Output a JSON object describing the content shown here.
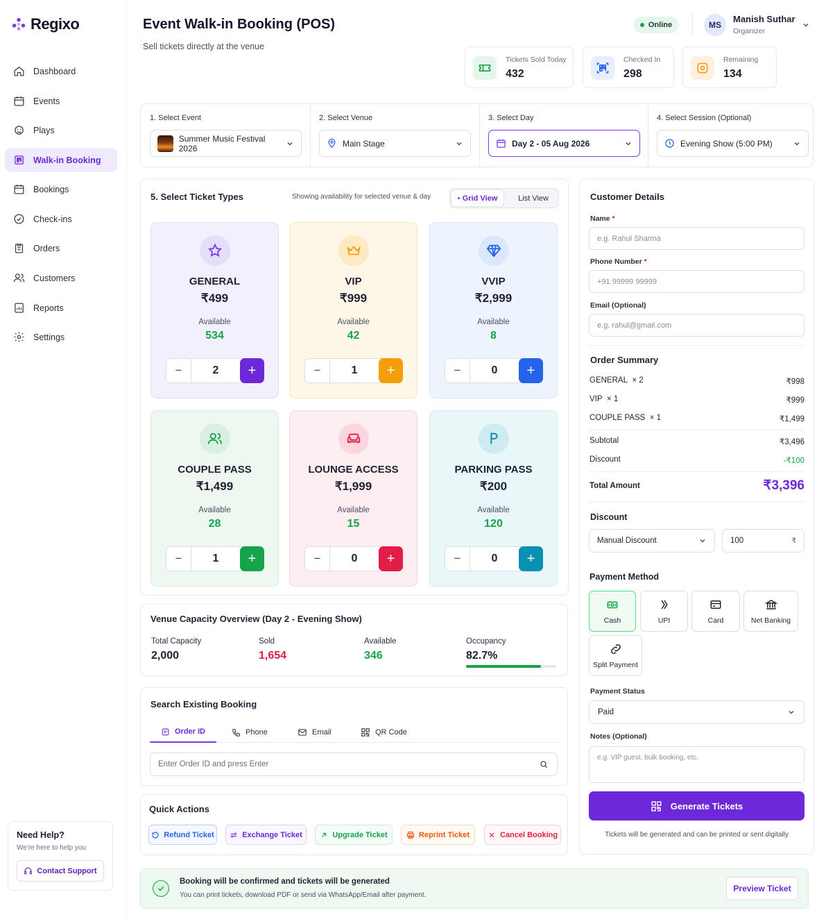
{
  "app": {
    "name": "Regixo"
  },
  "nav": {
    "items": [
      {
        "label": "Dashboard"
      },
      {
        "label": "Events"
      },
      {
        "label": "Plays"
      },
      {
        "label": "Walk-in Booking"
      },
      {
        "label": "Bookings"
      },
      {
        "label": "Check-ins"
      },
      {
        "label": "Orders"
      },
      {
        "label": "Customers"
      },
      {
        "label": "Reports"
      },
      {
        "label": "Settings"
      }
    ]
  },
  "help": {
    "title": "Need Help?",
    "subtitle": "We're here to help you",
    "button": "Contact Support"
  },
  "header": {
    "title": "Event Walk-in Booking (POS)",
    "subtitle": "Sell tickets directly at the venue",
    "status": "Online"
  },
  "user": {
    "initials": "MS",
    "name": "Manish Suthar",
    "role": "Organizer"
  },
  "stats": [
    {
      "label": "Tickets Sold Today",
      "value": "432"
    },
    {
      "label": "Checked In",
      "value": "298"
    },
    {
      "label": "Remaining",
      "value": "134"
    }
  ],
  "selectors": [
    {
      "label": "1. Select Event",
      "value": "Summer Music Festival 2026"
    },
    {
      "label": "2. Select Venue",
      "value": "Main Stage"
    },
    {
      "label": "3. Select Day",
      "value": "Day 2 - 05 Aug 2026"
    },
    {
      "label": "4. Select Session (Optional)",
      "value": "Evening Show (5:00 PM)"
    }
  ],
  "tickets": {
    "title": "5. Select Ticket Types",
    "note": "Showing availability for selected venue & day",
    "grid_view": "Grid View",
    "list_view": "List View",
    "available_label": "Available",
    "items": [
      {
        "name": "GENERAL",
        "price": "₹499",
        "available": "534",
        "qty": "2",
        "icon": "star-icon"
      },
      {
        "name": "VIP",
        "price": "₹999",
        "available": "42",
        "qty": "1",
        "icon": "crown-icon"
      },
      {
        "name": "VVIP",
        "price": "₹2,999",
        "available": "8",
        "qty": "0",
        "icon": "diamond-icon"
      },
      {
        "name": "COUPLE PASS",
        "price": "₹1,499",
        "available": "28",
        "qty": "1",
        "icon": "users-icon"
      },
      {
        "name": "LOUNGE ACCESS",
        "price": "₹1,999",
        "available": "15",
        "qty": "0",
        "icon": "sofa-icon"
      },
      {
        "name": "PARKING PASS",
        "price": "₹200",
        "available": "120",
        "qty": "0",
        "icon": "parking-icon"
      }
    ],
    "minus": "−",
    "plus": "+"
  },
  "capacity": {
    "title": "Venue Capacity Overview (Day 2 - Evening Show)",
    "total_label": "Total Capacity",
    "total": "2,000",
    "sold_label": "Sold",
    "sold": "1,654",
    "available_label": "Available",
    "available": "346",
    "occupancy_label": "Occupancy",
    "occupancy": "82.7%",
    "occupancy_fraction": 0.827
  },
  "search": {
    "title": "Search Existing Booking",
    "tabs": [
      {
        "label": "Order ID"
      },
      {
        "label": "Phone"
      },
      {
        "label": "Email"
      },
      {
        "label": "QR Code"
      }
    ],
    "placeholder": "Enter Order ID and press Enter"
  },
  "quick_actions": {
    "title": "Quick Actions",
    "items": [
      {
        "label": "Refund Ticket"
      },
      {
        "label": "Exchange Ticket"
      },
      {
        "label": "Upgrade Ticket"
      },
      {
        "label": "Reprint Ticket"
      },
      {
        "label": "Cancel Booking"
      }
    ]
  },
  "customer": {
    "title": "Customer Details",
    "name_label": "Name",
    "name_placeholder": "e.g. Rahul Sharma",
    "phone_label": "Phone Number",
    "phone_placeholder": "+91 99999 99999",
    "email_label": "Email (Optional)",
    "email_placeholder": "e.g. rahul@gmail.com",
    "required_mark": "*"
  },
  "summary": {
    "title": "Order Summary",
    "lines": [
      {
        "label": "GENERAL",
        "qty": "× 2",
        "amount": "₹998"
      },
      {
        "label": "VIP",
        "qty": "× 1",
        "amount": "₹999"
      },
      {
        "label": "COUPLE PASS",
        "qty": "× 1",
        "amount": "₹1,499"
      }
    ],
    "subtotal_label": "Subtotal",
    "subtotal": "₹3,496",
    "discount_label": "Discount",
    "discount": "-₹100",
    "total_label": "Total Amount",
    "total": "₹3,396"
  },
  "discount": {
    "title": "Discount",
    "type": "Manual Discount",
    "value": "100",
    "currency": "₹"
  },
  "payment": {
    "title": "Payment Method",
    "methods": [
      {
        "label": "Cash"
      },
      {
        "label": "UPI"
      },
      {
        "label": "Card"
      },
      {
        "label": "Net Banking"
      },
      {
        "label": "Split Payment"
      }
    ],
    "status_label": "Payment Status",
    "status": "Paid",
    "notes_label": "Notes (Optional)",
    "notes_placeholder": "e.g. VIP guest, bulk booking, etc.",
    "generate": "Generate Tickets",
    "generate_note": "Tickets will be generated and can be printed or sent digitally"
  },
  "banner": {
    "title": "Booking will be confirmed and tickets will be generated",
    "subtitle": "You can print tickets, download PDF or send via WhatsApp/Email after payment.",
    "button": "Preview Ticket"
  },
  "colors": {
    "accent": "#6d28d9",
    "success": "#16a34a",
    "danger": "#e11d48"
  }
}
